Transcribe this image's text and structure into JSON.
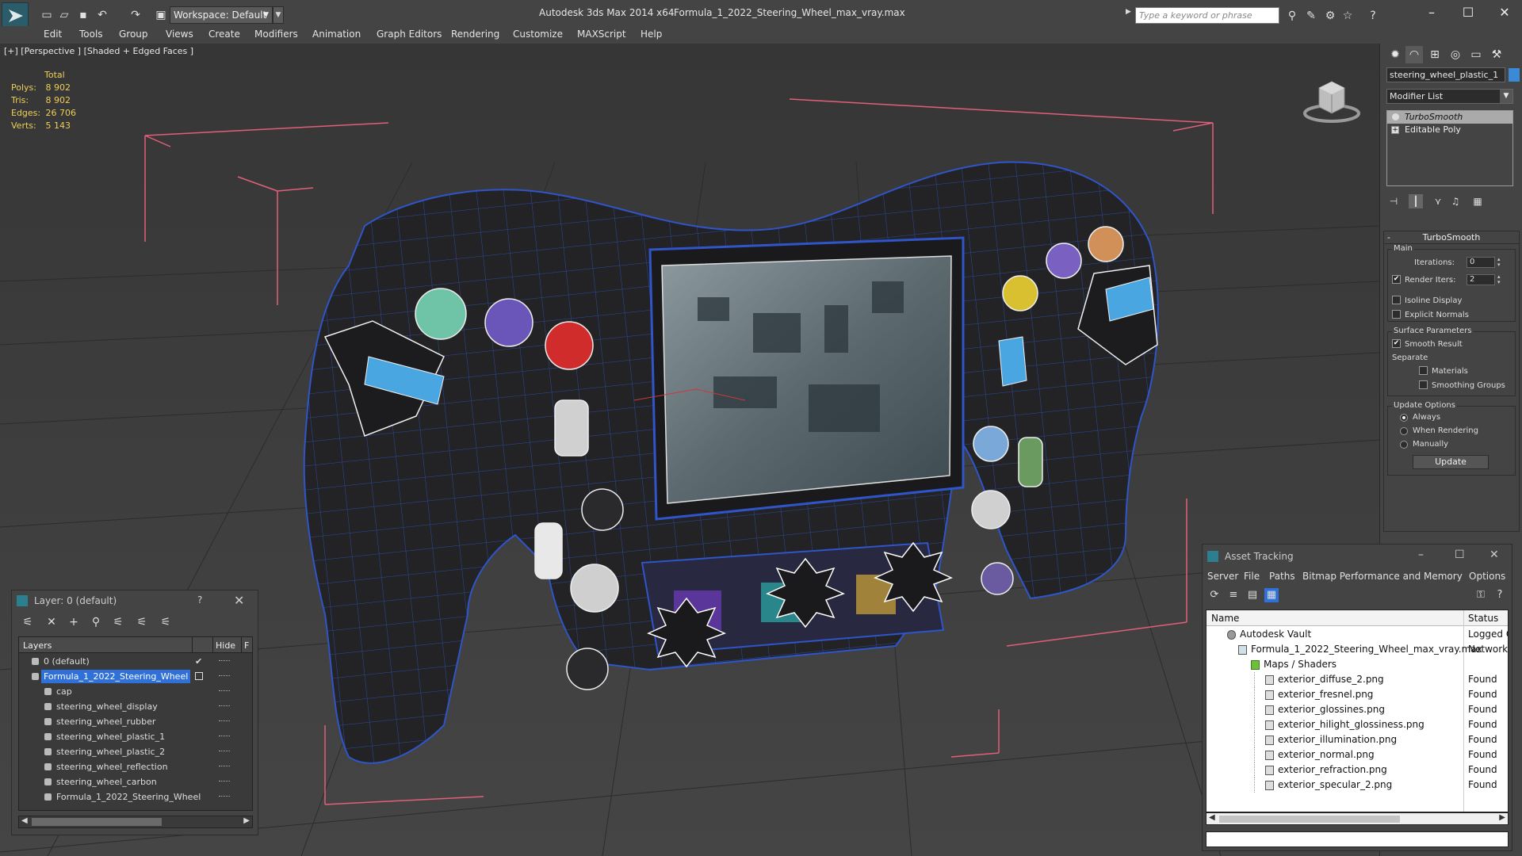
{
  "titlebar": {
    "workspace": "Workspace: Default",
    "app_title": "Autodesk 3ds Max  2014 x64",
    "file_title": "Formula_1_2022_Steering_Wheel_max_vray.max",
    "search_placeholder": "Type a keyword or phrase"
  },
  "menu": [
    "Edit",
    "Tools",
    "Group",
    "Views",
    "Create",
    "Modifiers",
    "Animation",
    "Graph Editors",
    "Rendering",
    "Customize",
    "MAXScript",
    "Help"
  ],
  "viewport": {
    "label": "[+] [Perspective ] [Shaded + Edged Faces ]",
    "stats": {
      "header": "Total",
      "rows": [
        {
          "label": "Polys:",
          "value": "8 902"
        },
        {
          "label": "Tris:",
          "value": "8 902"
        },
        {
          "label": "Edges:",
          "value": "26 706"
        },
        {
          "label": "Verts:",
          "value": "5 143"
        }
      ]
    }
  },
  "command_panel": {
    "object_name": "steering_wheel_plastic_1",
    "modifier_list": "Modifier List",
    "stack": [
      "TurboSmooth",
      "Editable Poly"
    ],
    "rollout_title": "TurboSmooth",
    "main_label": "Main",
    "iterations_label": "Iterations:",
    "iterations_value": "0",
    "render_iters_label": "Render Iters:",
    "render_iters_value": "2",
    "isoline_label": "Isoline Display",
    "explicit_label": "Explicit Normals",
    "surface_label": "Surface Parameters",
    "smooth_result_label": "Smooth Result",
    "separate_label": "Separate",
    "materials_label": "Materials",
    "smoothing_groups_label": "Smoothing Groups",
    "update_options_label": "Update Options",
    "always_label": "Always",
    "when_rendering_label": "When Rendering",
    "manually_label": "Manually",
    "update_button": "Update"
  },
  "layer_window": {
    "title": "Layer: 0 (default)",
    "help": "?",
    "col_layers": "Layers",
    "col_hide": "Hide",
    "col_f": "F",
    "rows": [
      {
        "name": "0 (default)"
      },
      {
        "name": "Formula_1_2022_Steering_Wheel"
      },
      {
        "name": "cap"
      },
      {
        "name": "steering_wheel_display"
      },
      {
        "name": "steering_wheel_rubber"
      },
      {
        "name": "steering_wheel_plastic_1"
      },
      {
        "name": "steering_wheel_plastic_2"
      },
      {
        "name": "steering_wheel_reflection"
      },
      {
        "name": "steering_wheel_carbon"
      },
      {
        "name": "Formula_1_2022_Steering_Wheel"
      }
    ]
  },
  "asset_window": {
    "title": "Asset Tracking",
    "menu": [
      "Server",
      "File",
      "Paths",
      "Bitmap Performance and Memory",
      "Options"
    ],
    "col_name": "Name",
    "col_status": "Status",
    "rows": [
      {
        "name": "Autodesk Vault",
        "status": "Logged O"
      },
      {
        "name": "Formula_1_2022_Steering_Wheel_max_vray.max",
        "status": "Network P"
      },
      {
        "name": "Maps / Shaders",
        "status": ""
      },
      {
        "name": "exterior_diffuse_2.png",
        "status": "Found"
      },
      {
        "name": "exterior_fresnel.png",
        "status": "Found"
      },
      {
        "name": "exterior_glossines.png",
        "status": "Found"
      },
      {
        "name": "exterior_hilight_glossiness.png",
        "status": "Found"
      },
      {
        "name": "exterior_illumination.png",
        "status": "Found"
      },
      {
        "name": "exterior_normal.png",
        "status": "Found"
      },
      {
        "name": "exterior_refraction.png",
        "status": "Found"
      },
      {
        "name": "exterior_specular_2.png",
        "status": "Found"
      }
    ]
  },
  "colors": {
    "accent": "#2f71d8",
    "stats": "#eecf5a",
    "bbox": "#e0607a",
    "wire": "#2f55c8"
  }
}
